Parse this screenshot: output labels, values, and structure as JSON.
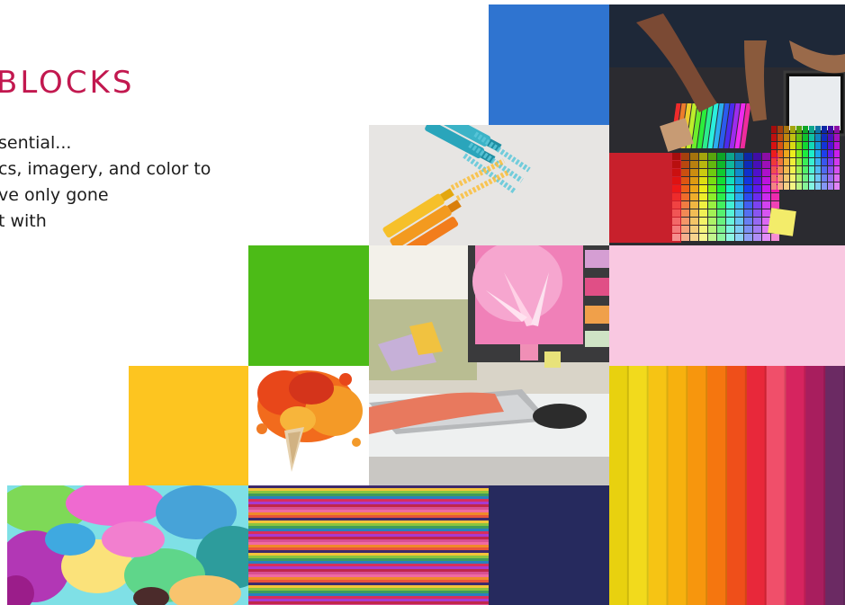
{
  "slide": {
    "title": "BLOCKS",
    "body_lines": [
      "sential...",
      "cs, imagery, and color to",
      "ve only gone",
      "t with"
    ]
  },
  "colors": {
    "title": "#c2184f",
    "blue_block": "#2f74d0",
    "green_block": "#4cbb17",
    "pink_block": "#f9c8e1",
    "yellow_block": "#fdc520",
    "navy_block": "#262a5e"
  },
  "tiles": [
    "blue-color-block",
    "designers-color-swatches-photo",
    "highlighter-markers-photo",
    "green-color-block",
    "computer-desk-photo",
    "pink-color-block",
    "yellow-color-block",
    "ice-cream-splash-photo",
    "rainbow-strips-photo",
    "paint-splash-photo",
    "horizontal-stripes-pattern",
    "navy-color-block"
  ]
}
